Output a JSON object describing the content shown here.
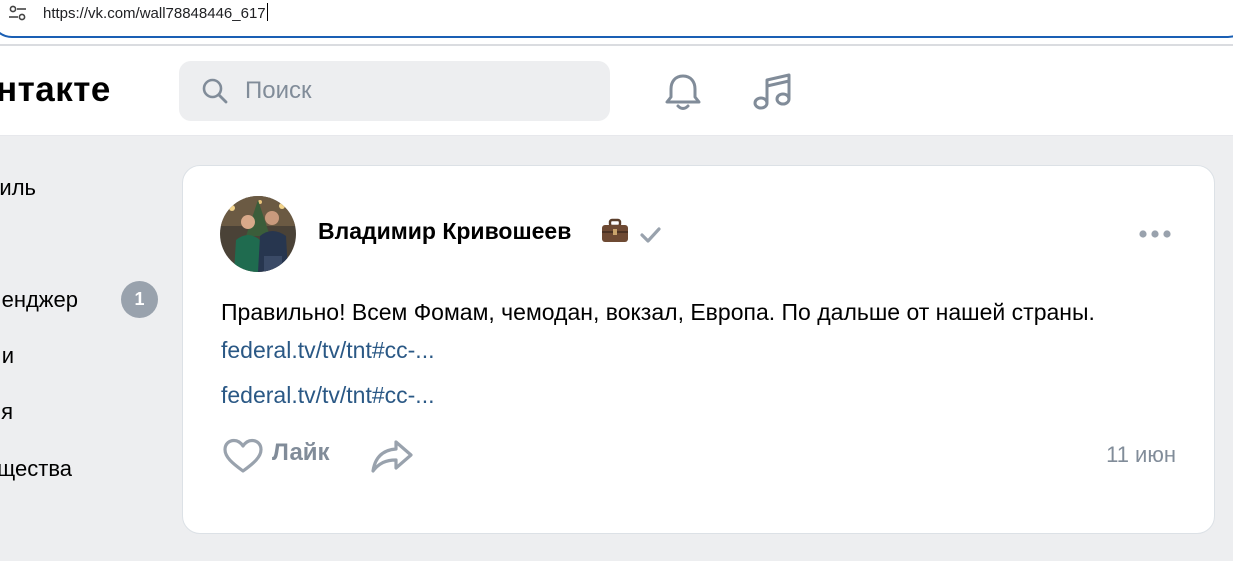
{
  "browser": {
    "url": "https://vk.com/wall78848446_617",
    "site_info_icon": "tune-icon"
  },
  "header": {
    "logo_text": "нтакте",
    "search": {
      "placeholder": "Поиск",
      "value": ""
    },
    "icons": [
      "search-icon",
      "bell-icon",
      "music-note-icon"
    ]
  },
  "sidebar": {
    "items": [
      {
        "label": "иль"
      },
      {
        "label": "енджер",
        "badge": "1"
      },
      {
        "label": "и"
      },
      {
        "label": "я"
      },
      {
        "label": "щества"
      }
    ]
  },
  "post": {
    "author": "Владимир Кривошеев",
    "author_icons": [
      "briefcase-icon",
      "verified-check-icon"
    ],
    "text": "Правильно! Всем Фомам, чемодан, вокзал, Европа. По дальше от нашей страны.",
    "inline_link": "federal.tv/tv/tnt#cc-...",
    "attachment_link": "federal.tv/tv/tnt#cc-...",
    "like_label": "Лайк",
    "date": "11 июн"
  },
  "colors": {
    "link": "#2a5885",
    "secondary_text": "#818c99",
    "page_bg": "#edeef0",
    "badge_bg": "#99a2ad",
    "url_focus_border": "#1a5fb4"
  }
}
